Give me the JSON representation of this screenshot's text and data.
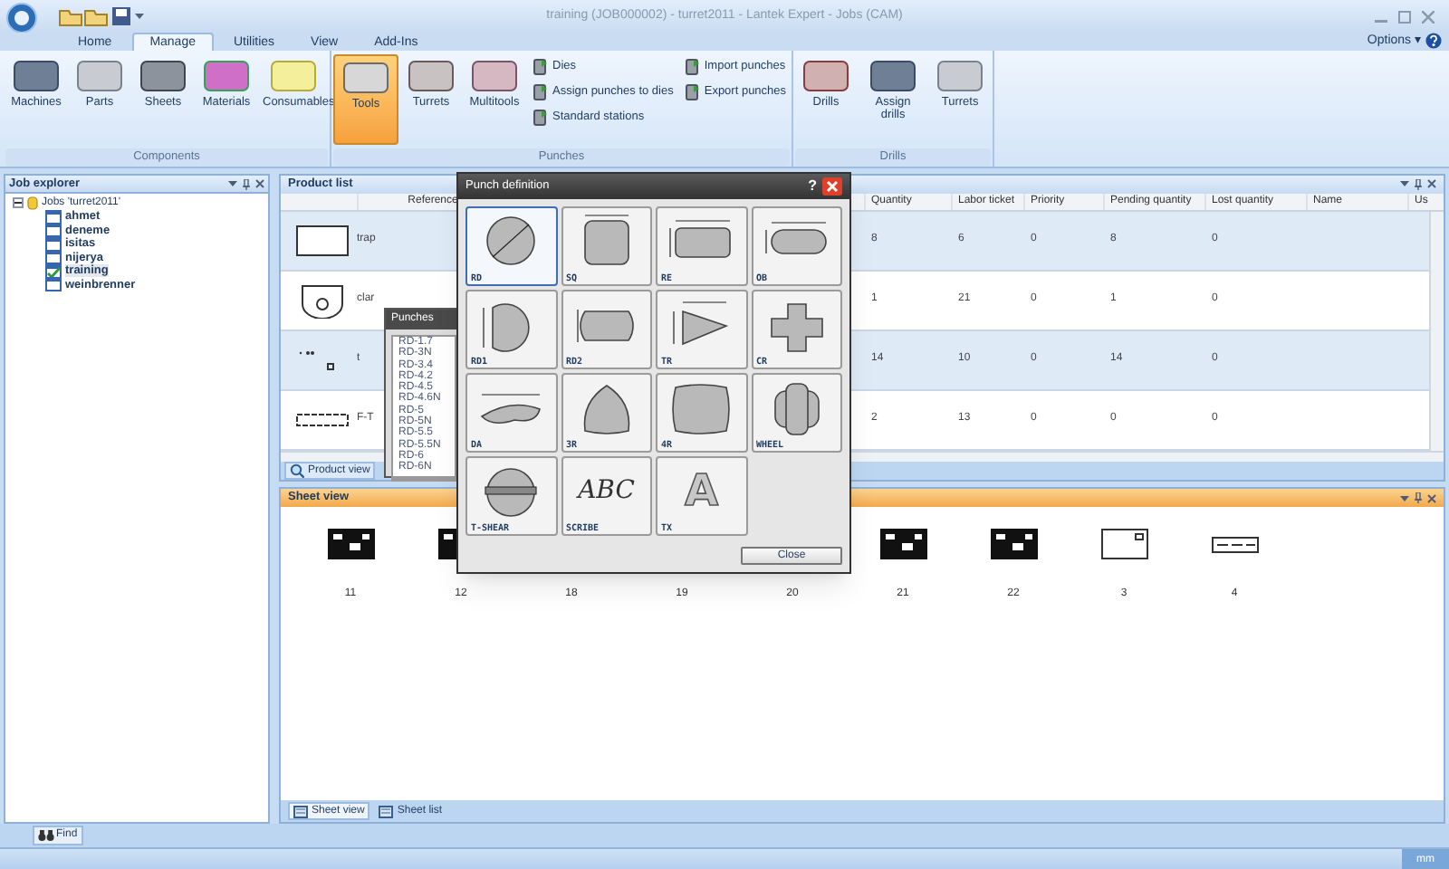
{
  "window": {
    "title": "training (JOB000002) - turret2011 - Lantek Expert - Jobs (CAM)"
  },
  "ribbon_tabs": [
    {
      "label": "Home",
      "selected": false
    },
    {
      "label": "Manage",
      "selected": true
    },
    {
      "label": "Utilities",
      "selected": false
    },
    {
      "label": "View",
      "selected": false
    },
    {
      "label": "Add-Ins",
      "selected": false
    }
  ],
  "options": {
    "label": "Options ▾"
  },
  "ribbon_groups": [
    {
      "label": "Components",
      "items": [
        {
          "kind": "large",
          "label": "Machines",
          "selected": false
        },
        {
          "kind": "large",
          "label": "Parts",
          "selected": false
        },
        {
          "kind": "large",
          "label": "Sheets",
          "selected": false
        },
        {
          "kind": "large",
          "label": "Materials",
          "selected": false
        },
        {
          "kind": "large",
          "label": "Consumables",
          "selected": false
        }
      ]
    },
    {
      "label": "Punches",
      "items": [
        {
          "kind": "large",
          "label": "Tools",
          "selected": true
        },
        {
          "kind": "large",
          "label": "Turrets",
          "selected": false
        },
        {
          "kind": "large",
          "label": "Multitools",
          "selected": false
        },
        {
          "kind": "small",
          "label": "Dies",
          "selected": false
        },
        {
          "kind": "small",
          "label": "Assign punches to dies",
          "selected": false
        },
        {
          "kind": "small",
          "label": "Standard stations",
          "selected": false
        },
        {
          "kind": "small",
          "label": "Import punches",
          "selected": false
        },
        {
          "kind": "small",
          "label": "Export punches",
          "selected": false
        }
      ]
    },
    {
      "label": "Drills",
      "items": [
        {
          "kind": "large",
          "label": "Drills",
          "selected": false
        },
        {
          "kind": "large",
          "label": "Assign drills",
          "selected": false
        },
        {
          "kind": "large",
          "label": "Turrets",
          "selected": false
        }
      ]
    }
  ],
  "job_explorer": {
    "title": "Job explorer",
    "tree": [
      {
        "label": "Jobs 'turret2011'",
        "expanded": true,
        "children": [
          {
            "label": "ahmet",
            "checked": false,
            "selected": false
          },
          {
            "label": "deneme",
            "checked": false,
            "selected": false
          },
          {
            "label": "isitas",
            "checked": false,
            "selected": false
          },
          {
            "label": "nijerya",
            "checked": false,
            "selected": false
          },
          {
            "label": "training",
            "checked": true,
            "selected": true
          },
          {
            "label": "weinbrenner",
            "checked": false,
            "selected": false
          }
        ]
      }
    ]
  },
  "product_list": {
    "title": "Product list",
    "columns": [
      "Reference",
      "Quantity",
      "Labor ticket",
      "Priority",
      "Pending quantity",
      "Lost quantity",
      "Name",
      "Us"
    ],
    "rows": [
      {
        "reference": "trap",
        "quantity": "8",
        "labor_ticket": "6",
        "priority": "0",
        "pending_quantity": "8",
        "lost_quantity": "0"
      },
      {
        "reference": "clar",
        "quantity": "1",
        "labor_ticket": "21",
        "priority": "0",
        "pending_quantity": "1",
        "lost_quantity": "0"
      },
      {
        "reference": "t",
        "quantity": "14",
        "labor_ticket": "10",
        "priority": "0",
        "pending_quantity": "14",
        "lost_quantity": "0"
      },
      {
        "reference": "F-T",
        "quantity": "2",
        "labor_ticket": "13",
        "priority": "0",
        "pending_quantity": "0",
        "lost_quantity": "0"
      }
    ],
    "tab": "Product view"
  },
  "sheet_view": {
    "title": "Sheet view",
    "sheets": [
      "11",
      "12",
      "18",
      "19",
      "20",
      "21",
      "22",
      "3",
      "4"
    ],
    "tabs": [
      {
        "label": "Sheet view",
        "selected": true
      },
      {
        "label": "Sheet list",
        "selected": false
      }
    ]
  },
  "find_button": "Find",
  "status_bar": {
    "units": "mm"
  },
  "punches_popup": {
    "title": "Punches",
    "items": [
      "RD-1.7",
      "RD-3N",
      "RD-3.4",
      "RD-4.2",
      "RD-4.5",
      "RD-4.6N",
      "RD-5",
      "RD-5N",
      "RD-5.5",
      "RD-5.5N",
      "RD-6",
      "RD-6N"
    ]
  },
  "punch_dialog": {
    "title": "Punch definition",
    "help": "?",
    "tiles": [
      {
        "kind": "circle",
        "label": "RD",
        "selected": true
      },
      {
        "kind": "square",
        "label": "SQ",
        "selected": false
      },
      {
        "kind": "rect",
        "label": "RE",
        "selected": false
      },
      {
        "kind": "obround",
        "label": "OB",
        "selected": false
      },
      {
        "kind": "single_d",
        "label": "RD1",
        "selected": false
      },
      {
        "kind": "double_d",
        "label": "RD2",
        "selected": false
      },
      {
        "kind": "triangle",
        "label": "TR",
        "selected": false
      },
      {
        "kind": "cross",
        "label": "CR",
        "selected": false
      },
      {
        "kind": "dart",
        "label": "DA",
        "selected": false
      },
      {
        "kind": "tri_round",
        "label": "3R",
        "selected": false
      },
      {
        "kind": "quad_round",
        "label": "4R",
        "selected": false
      },
      {
        "kind": "wheel",
        "label": "WHEEL",
        "selected": false
      },
      {
        "kind": "t_shear",
        "label": "T-SHEAR",
        "selected": false
      },
      {
        "kind": "text",
        "glyph": "ABC",
        "label": "SCRIBE",
        "selected": false
      },
      {
        "kind": "text",
        "glyph": "A",
        "label": "TX",
        "selected": false
      }
    ],
    "close": "Close"
  }
}
